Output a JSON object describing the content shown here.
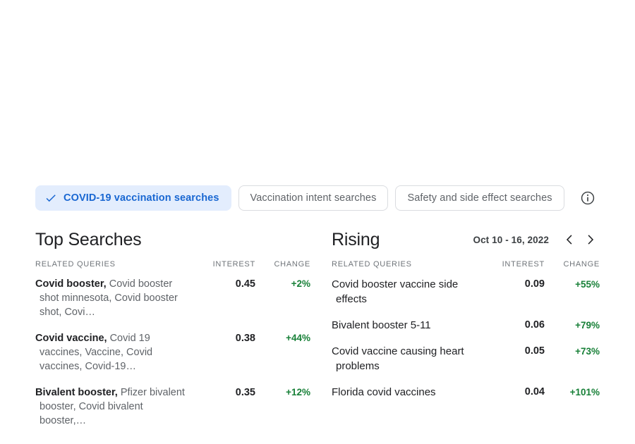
{
  "filters": {
    "chips": [
      {
        "label": "COVID-19 vaccination searches",
        "active": true,
        "icon": "check-icon"
      },
      {
        "label": "Vaccination intent searches",
        "active": false
      },
      {
        "label": "Safety and side effect searches",
        "active": false
      }
    ],
    "info_icon": "info-circle-icon"
  },
  "colors": {
    "accent_blue": "#1967d2",
    "chip_active_bg": "#e3edfd",
    "positive_green": "#188038",
    "text_primary": "#202124",
    "text_secondary": "#5f6368"
  },
  "panels": {
    "top": {
      "title": "Top Searches",
      "columns": {
        "query": "RELATED QUERIES",
        "interest": "INTEREST",
        "change": "CHANGE"
      },
      "rows": [
        {
          "lead": "Covid booster,",
          "rest": " Covid booster shot minnesota, Covid booster shot, Covi…",
          "interest": "0.45",
          "change": "+2%"
        },
        {
          "lead": "Covid vaccine,",
          "rest": " Covid 19 vaccines, Vaccine, Covid vaccines, Covid-19…",
          "interest": "0.38",
          "change": "+44%"
        },
        {
          "lead": "Bivalent booster,",
          "rest": " Pfizer bivalent booster, Covid bivalent booster,…",
          "interest": "0.35",
          "change": "+12%"
        }
      ]
    },
    "rising": {
      "title": "Rising",
      "date_range": "Oct 10 - 16, 2022",
      "prev_icon": "chevron-left-icon",
      "next_icon": "chevron-right-icon",
      "columns": {
        "query": "RELATED QUERIES",
        "interest": "INTEREST",
        "change": "CHANGE"
      },
      "rows": [
        {
          "query": "Covid booster vaccine side effects",
          "interest": "0.09",
          "change": "+55%"
        },
        {
          "query": "Bivalent booster 5-11",
          "interest": "0.06",
          "change": "+79%"
        },
        {
          "query": "Covid vaccine causing heart problems",
          "interest": "0.05",
          "change": "+73%"
        },
        {
          "query": "Florida covid vaccines",
          "interest": "0.04",
          "change": "+101%"
        }
      ]
    }
  }
}
